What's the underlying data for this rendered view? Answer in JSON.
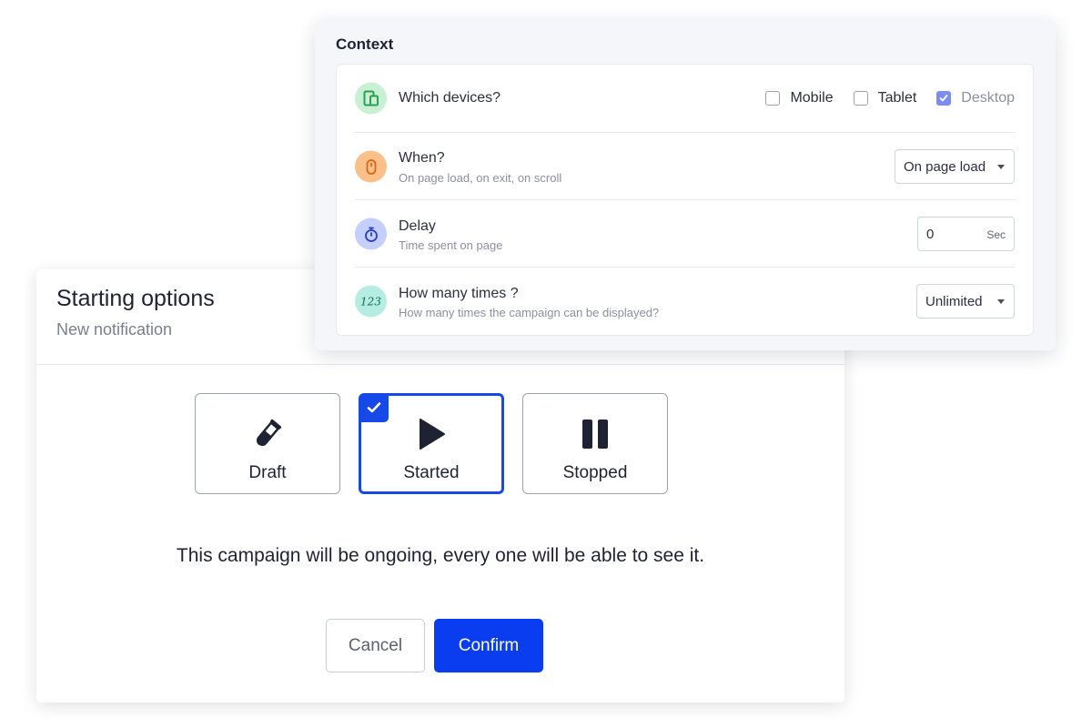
{
  "context": {
    "title": "Context",
    "devices": {
      "title": "Which devices?",
      "icon": "devices-icon",
      "options": [
        {
          "label": "Mobile",
          "checked": false
        },
        {
          "label": "Tablet",
          "checked": false
        },
        {
          "label": "Desktop",
          "checked": true
        }
      ]
    },
    "when": {
      "title": "When?",
      "subtitle": "On page load, on exit, on scroll",
      "icon": "mouse-icon",
      "value": "On page load"
    },
    "delay": {
      "title": "Delay",
      "subtitle": "Time spent on page",
      "icon": "stopwatch-icon",
      "value": "0",
      "unit": "Sec"
    },
    "times": {
      "title": "How many times ?",
      "subtitle": "How many times the campaign can be displayed?",
      "icon": "numbers-icon",
      "icon_text": "123",
      "value": "Unlimited"
    }
  },
  "starting": {
    "title": "Starting options",
    "subtitle": "New notification",
    "options": [
      {
        "label": "Draft",
        "icon": "test-tube-icon",
        "selected": false
      },
      {
        "label": "Started",
        "icon": "play-icon",
        "selected": true
      },
      {
        "label": "Stopped",
        "icon": "pause-icon",
        "selected": false
      }
    ],
    "message": "This campaign will be ongoing, every one will be able to see it.",
    "cancel_label": "Cancel",
    "confirm_label": "Confirm"
  },
  "colors": {
    "accent": "#1649e8",
    "confirm": "#0a3df0",
    "checkbox_checked": "#7b8ef0",
    "icon_green_bg": "#c8f0d2",
    "icon_orange_bg": "#f9c08a",
    "icon_blue_bg": "#c5cffb",
    "icon_teal_bg": "#b6ede3"
  }
}
